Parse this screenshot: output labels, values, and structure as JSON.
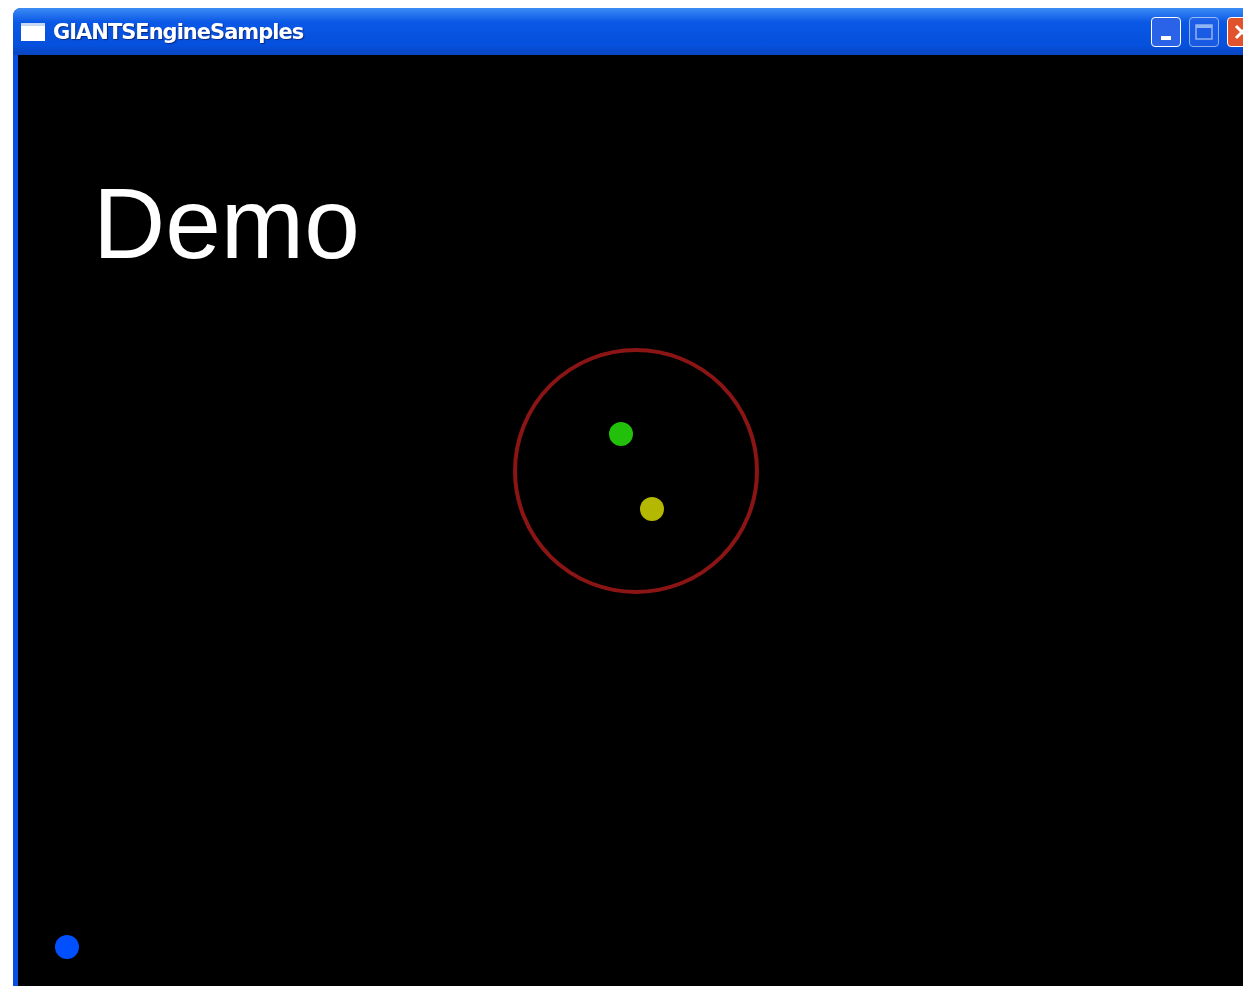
{
  "window": {
    "title": "GIANTSEngineSamples"
  },
  "title_buttons": [
    {
      "kind": "minimize",
      "disabled": false
    },
    {
      "kind": "maximize",
      "disabled": true
    },
    {
      "kind": "close",
      "disabled": false
    }
  ],
  "canvas": {
    "label": "Demo",
    "ring": {
      "color": "#8b1414"
    },
    "dots": [
      {
        "color": "#22c00a"
      },
      {
        "color": "#b4b800"
      },
      {
        "color": "#0050ff"
      }
    ]
  }
}
